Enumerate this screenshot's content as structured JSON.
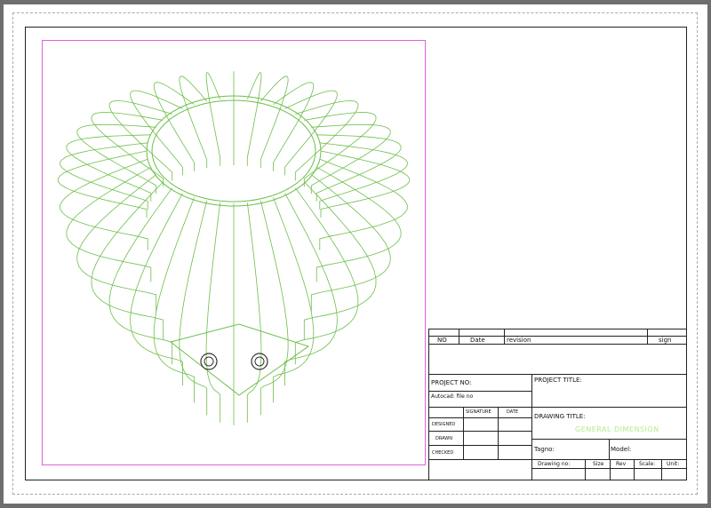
{
  "title_block": {
    "revision_header": {
      "no": "NO",
      "date": "Date",
      "revision": "revision",
      "sign": "sign"
    },
    "project_no_label": "PROJECT NO:",
    "autocad_file_label": "Autocad: file no",
    "signature_header": "SIGNATURE",
    "date_header": "DATE",
    "designed_label": "DESIGNED",
    "drawn_label": "DRAWN",
    "checked_label": "CHECKED",
    "project_title_label": "PROJECT TITLE:",
    "drawing_title_label": "DRAWING TITLE:",
    "drawing_title_value": "GENERAL DIMENSION",
    "tagno_label": "Tagno:",
    "model_label": "Model:",
    "drawing_no_label": "Drawing no:",
    "size_label": "Size",
    "rev_label": "Rev",
    "scale_label": "Scale:",
    "unit_label": "Unit:"
  },
  "colors": {
    "wireframe": "#6cbf4a",
    "viewport": "#e060e0",
    "title_value": "#b6eb8e"
  }
}
